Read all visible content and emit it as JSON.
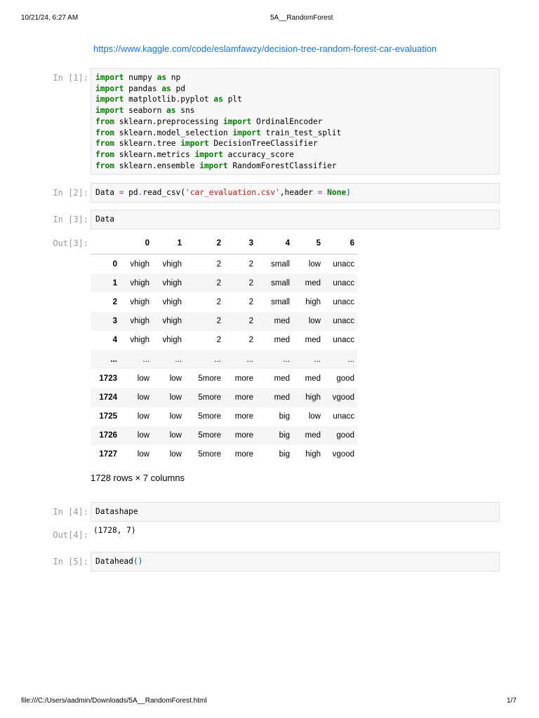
{
  "header": {
    "datetime": "10/21/24, 6:27 AM",
    "title": "5A__RandomForest"
  },
  "footer": {
    "path": "file:///C:/Users/aadmin/Downloads/5A__RandomForest.html",
    "page": "1/7"
  },
  "link": "https://www.kaggle.com/code/eslamfawzy/decision-tree-random-forest-car-evaluation",
  "cells": {
    "c1": {
      "prompt": "In [1]:",
      "lines": [
        [
          "import",
          " numpy ",
          "as",
          " np"
        ],
        [
          "import",
          " pandas ",
          "as",
          " pd"
        ],
        [
          "import",
          " matplotlib.pyplot ",
          "as",
          " plt"
        ],
        [
          "import",
          " seaborn ",
          "as",
          " sns"
        ],
        [
          "from",
          " sklearn.preprocessing ",
          "import",
          " OrdinalEncoder"
        ],
        [
          "from",
          " sklearn.model_selection ",
          "import",
          " train_test_split"
        ],
        [
          "from",
          " sklearn.tree ",
          "import",
          " DecisionTreeClassifier"
        ],
        [
          "from",
          " sklearn.metrics ",
          "import",
          " accuracy_score"
        ],
        [
          "from",
          " sklearn.ensemble ",
          "import",
          " RandomForestClassifier"
        ]
      ]
    },
    "c2": {
      "prompt": "In [2]:",
      "a": "Data ",
      "eq": "=",
      "b": " pd",
      "dot": ".",
      "c": "read_csv(",
      "s": "'car_evaluation.csv'",
      "d": ",header ",
      "eq2": "=",
      "none": "None",
      ")": ")"
    },
    "c3": {
      "prompt": "In [3]:",
      "code": "Data",
      "out_prompt": "Out[3]:"
    },
    "c4": {
      "prompt": "In [4]:",
      "a": "Data",
      ".": ".",
      "b": "shape",
      "out_prompt": "Out[4]:",
      "output": "(1728, 7)"
    },
    "c5": {
      "prompt": "In [5]:",
      "a": "Data",
      ".": ".",
      "b": "head",
      "p": "()"
    }
  },
  "table": {
    "columns": [
      "",
      "0",
      "1",
      "2",
      "3",
      "4",
      "5",
      "6"
    ],
    "rows": [
      [
        "0",
        "vhigh",
        "vhigh",
        "2",
        "2",
        "small",
        "low",
        "unacc"
      ],
      [
        "1",
        "vhigh",
        "vhigh",
        "2",
        "2",
        "small",
        "med",
        "unacc"
      ],
      [
        "2",
        "vhigh",
        "vhigh",
        "2",
        "2",
        "small",
        "high",
        "unacc"
      ],
      [
        "3",
        "vhigh",
        "vhigh",
        "2",
        "2",
        "med",
        "low",
        "unacc"
      ],
      [
        "4",
        "vhigh",
        "vhigh",
        "2",
        "2",
        "med",
        "med",
        "unacc"
      ],
      [
        "...",
        "...",
        "...",
        "...",
        "...",
        "...",
        "...",
        "..."
      ],
      [
        "1723",
        "low",
        "low",
        "5more",
        "more",
        "med",
        "med",
        "good"
      ],
      [
        "1724",
        "low",
        "low",
        "5more",
        "more",
        "med",
        "high",
        "vgood"
      ],
      [
        "1725",
        "low",
        "low",
        "5more",
        "more",
        "big",
        "low",
        "unacc"
      ],
      [
        "1726",
        "low",
        "low",
        "5more",
        "more",
        "big",
        "med",
        "good"
      ],
      [
        "1727",
        "low",
        "low",
        "5more",
        "more",
        "big",
        "high",
        "vgood"
      ]
    ],
    "dims": "1728 rows × 7 columns"
  }
}
